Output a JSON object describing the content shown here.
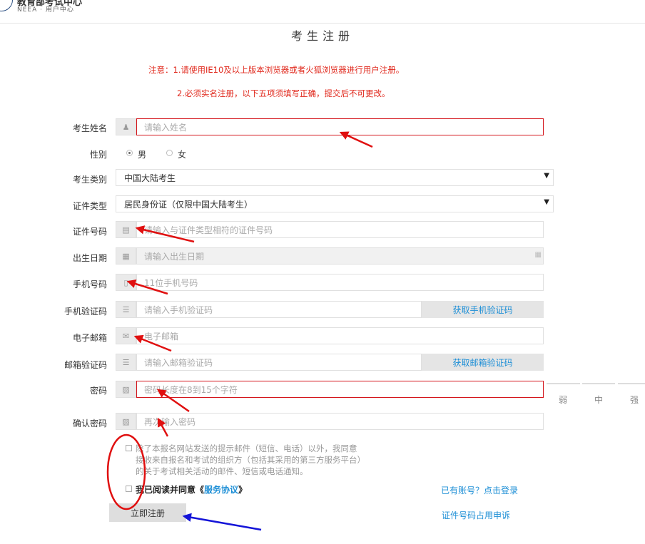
{
  "header": {
    "logo_title": "教育部考试中心",
    "logo_subtitle": "NEEA · 用户中心"
  },
  "page_title": "考生注册",
  "notices": [
    "注意：1.请使用IE10及以上版本浏览器或者火狐浏览器进行用户注册。",
    "2.必须实名注册，以下五项须填写正确，提交后不可更改。"
  ],
  "form": {
    "name": {
      "label": "考生姓名",
      "placeholder": "请输入姓名"
    },
    "gender": {
      "label": "性别",
      "options": [
        "男",
        "女"
      ],
      "selected": "男"
    },
    "category": {
      "label": "考生类别",
      "value": "中国大陆考生"
    },
    "id_type": {
      "label": "证件类型",
      "value": "居民身份证（仅限中国大陆考生）"
    },
    "id_number": {
      "label": "证件号码",
      "placeholder": "请输入与证件类型相符的证件号码"
    },
    "birth_date": {
      "label": "出生日期",
      "placeholder": "请输入出生日期"
    },
    "phone": {
      "label": "手机号码",
      "placeholder": "11位手机号码"
    },
    "phone_code": {
      "label": "手机验证码",
      "placeholder": "请输入手机验证码",
      "button": "获取手机验证码"
    },
    "email": {
      "label": "电子邮箱",
      "placeholder": "电子邮箱"
    },
    "email_code": {
      "label": "邮箱验证码",
      "placeholder": "请输入邮箱验证码",
      "button": "获取邮箱验证码"
    },
    "password": {
      "label": "密码",
      "placeholder": "密码长度在8到15个字符",
      "strength": [
        "弱",
        "中",
        "强"
      ]
    },
    "confirm_password": {
      "label": "确认密码",
      "placeholder": "再次输入密码"
    }
  },
  "consent_text": "除了本报名网站发送的提示邮件（短信、电话）以外，我同意接收来自报名和考试的组织方（包括其采用的第三方服务平台）的关于考试相关活动的邮件、短信或电话通知。",
  "agree": {
    "prefix": "我已阅读并同意《",
    "link": "服务协议",
    "suffix": "》"
  },
  "links": {
    "login": "已有账号？点击登录",
    "appeal": "证件号码占用申诉"
  },
  "submit_label": "立即注册",
  "colors": {
    "error_red": "#d4161c",
    "link_blue": "#1e8fd6",
    "annotation_red": "#e01010",
    "annotation_blue": "#1414d8"
  }
}
